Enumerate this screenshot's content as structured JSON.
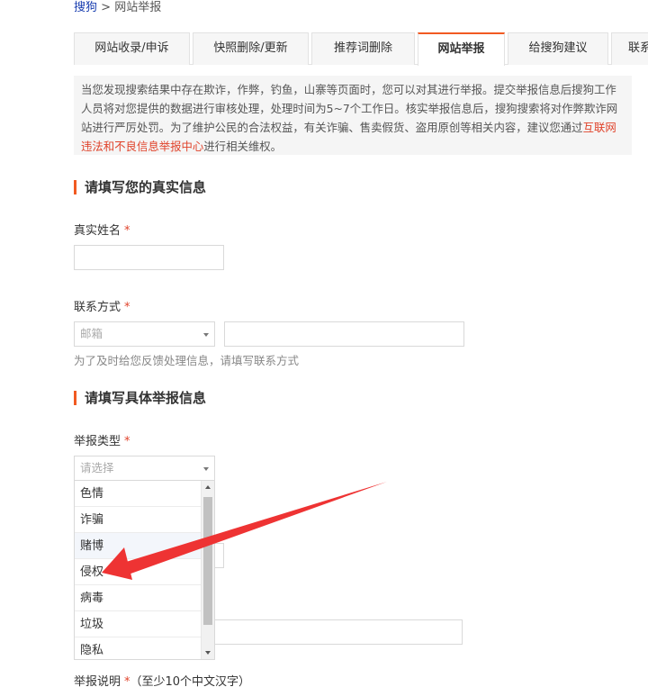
{
  "breadcrumb": {
    "home": "搜狗",
    "separator": ">",
    "current": "网站举报"
  },
  "tabs": [
    {
      "label": "网站收录/申诉"
    },
    {
      "label": "快照删除/更新"
    },
    {
      "label": "推荐词删除"
    },
    {
      "label": "网站举报"
    },
    {
      "label": "给搜狗建议"
    },
    {
      "label": "联系"
    }
  ],
  "notice": {
    "text_before": "当您发现搜索结果中存在欺诈，作弊，钓鱼，山寨等页面时，您可以对其进行举报。提交举报信息后搜狗工作人员将对您提供的数据进行审核处理，处理时间为5~7个工作日。核实举报信息后，搜狗搜索将对作弊欺诈网站进行严厉处罚。为了维护公民的合法权益，有关诈骗、售卖假货、盗用原创等相关内容，建议您通过",
    "link": "互联网违法和不良信息举报中心",
    "text_after": "进行相关维权。"
  },
  "section1": {
    "title": "请填写您的真实信息"
  },
  "name_field": {
    "label": "真实姓名",
    "required": "*"
  },
  "contact_field": {
    "label": "联系方式",
    "required": "*",
    "select_value": "邮箱",
    "hint": "为了及时给您反馈处理信息，请填写联系方式"
  },
  "section2": {
    "title": "请填写具体举报信息"
  },
  "report_type": {
    "label": "举报类型",
    "required": "*",
    "placeholder": "请选择",
    "options": [
      "色情",
      "诈骗",
      "赌博",
      "侵权",
      "病毒",
      "垃圾",
      "隐私"
    ]
  },
  "description_field": {
    "label": "举报说明",
    "required": "*",
    "note": "（至少10个中文汉字）"
  },
  "colors": {
    "accent": "#f15a22",
    "link": "#e0432b",
    "arrow": "#ee3333"
  }
}
